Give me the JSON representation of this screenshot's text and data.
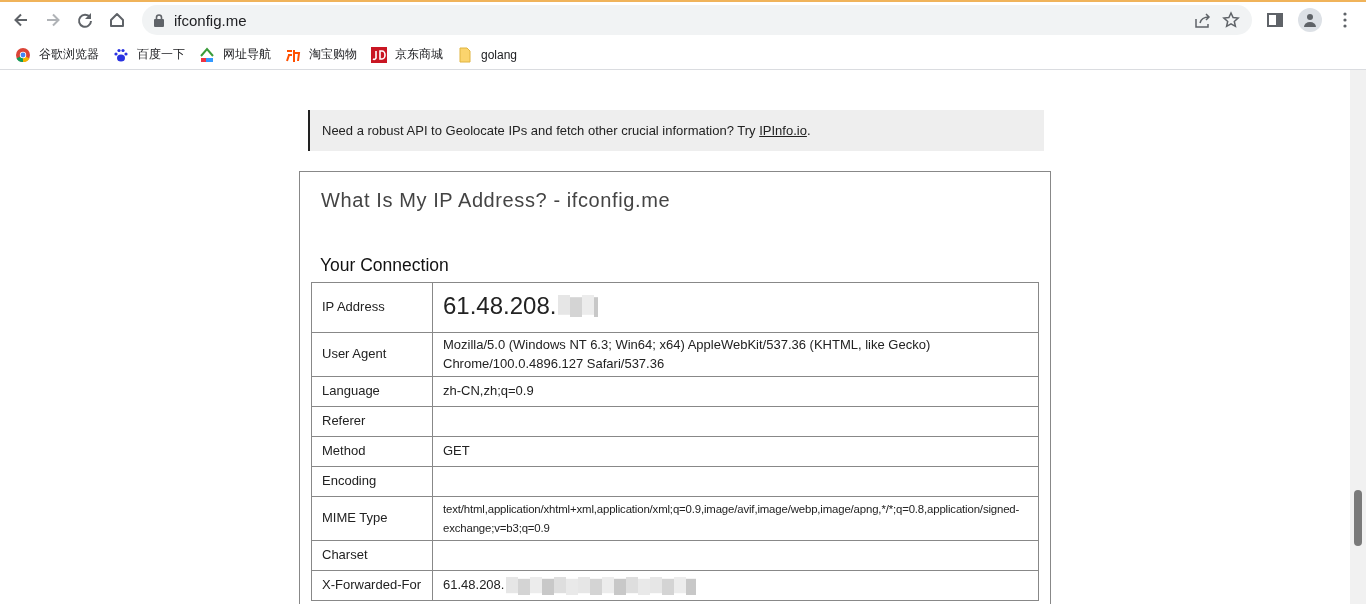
{
  "browser": {
    "url": "ifconfig.me",
    "bookmarks": [
      {
        "label": "谷歌浏览器",
        "kind": "chrome"
      },
      {
        "label": "百度一下",
        "kind": "paw"
      },
      {
        "label": "网址导航",
        "kind": "house"
      },
      {
        "label": "淘宝购物",
        "kind": "tao"
      },
      {
        "label": "京东商城",
        "kind": "jd"
      },
      {
        "label": "golang",
        "kind": "folder"
      }
    ]
  },
  "banner": {
    "text": "Need a robust API to Geolocate IPs and fetch other crucial information? Try ",
    "link": "IPInfo.io",
    "after": "."
  },
  "page": {
    "title": "What Is My IP Address? - ifconfig.me",
    "section": "Your Connection",
    "rows": [
      {
        "label": "IP Address",
        "value": "61.48.208.",
        "kind": "large",
        "redacted": true
      },
      {
        "label": "User Agent",
        "value": "Mozilla/5.0 (Windows NT 6.3; Win64; x64) AppleWebKit/537.36 (KHTML, like Gecko) Chrome/100.0.4896.127 Safari/537.36",
        "kind": "text",
        "redacted": false
      },
      {
        "label": "Language",
        "value": "zh-CN,zh;q=0.9",
        "kind": "text",
        "redacted": false
      },
      {
        "label": "Referer",
        "kind": "empty",
        "redacted": false
      },
      {
        "label": "Method",
        "value": "GET",
        "kind": "text",
        "redacted": false
      },
      {
        "label": "Encoding",
        "kind": "empty",
        "redacted": false
      },
      {
        "label": "MIME Type",
        "value": "text/html,application/xhtml+xml,application/xml;q=0.9,image/avif,image/webp,image/apng,*/*;q=0.8,application/signed-exchange;v=b3;q=0.9",
        "kind": "wide",
        "redacted": false
      },
      {
        "label": "Charset",
        "kind": "empty",
        "redacted": false
      },
      {
        "label": "X-Forwarded-For",
        "value": "61.48.208.",
        "kind": "text",
        "redacted": true
      }
    ]
  }
}
